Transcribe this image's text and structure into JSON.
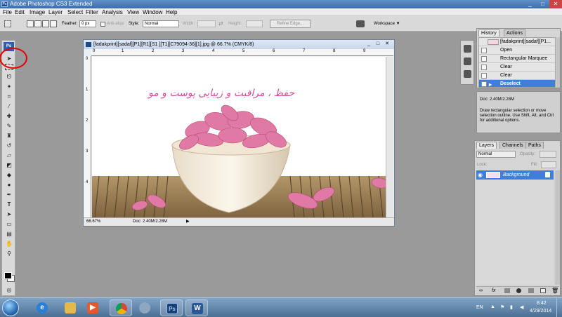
{
  "app": {
    "title": "Adobe Photoshop CS3 Extended",
    "icon_label": "Ps",
    "window_controls": [
      "_",
      "□",
      "✕"
    ]
  },
  "menu": [
    "File",
    "Edit",
    "Image",
    "Layer",
    "Select",
    "Filter",
    "Analysis",
    "View",
    "Window",
    "Help"
  ],
  "options": {
    "feather_label": "Feather:",
    "feather_value": "0 px",
    "antialias_label": "Anti-alias",
    "style_label": "Style:",
    "style_value": "Normal",
    "width_label": "Width:",
    "height_label": "Height:",
    "refine_edge": "Refine Edge...",
    "workspace": "Workspace ▼"
  },
  "document": {
    "title": "[fadakprint][sadaf][P1][R1][S1 ][T1][C79094-36][1].jpg @ 66.7% (CMYK/8)",
    "zoom": "66.67%",
    "doc_size": "Doc: 2.40M/2.28M",
    "ruler_top": [
      "0",
      "1",
      "2",
      "3",
      "4",
      "5",
      "6",
      "7",
      "8",
      "9"
    ],
    "ruler_left": [
      "0",
      "1",
      "2",
      "3",
      "4"
    ],
    "calligraphy": "حفظ ، مراقبت و زیبایی پوست و مو"
  },
  "history": {
    "tabs": [
      "History",
      "Actions"
    ],
    "snapshot": "[fadakprint][sadaf][P1...",
    "items": [
      "Open",
      "Rectangular Marquee",
      "Clear",
      "Clear",
      "Deselect"
    ],
    "selected_index": 4
  },
  "info": {
    "doc": "Doc: 2.40M/2.28M",
    "hint": "Draw rectangular selection or move selection outline. Use Shift, Alt, and Ctrl for additional options."
  },
  "layers": {
    "tabs": [
      "Layers",
      "Channels",
      "Paths"
    ],
    "blend_mode": "Normal",
    "opacity_label": "Opacity:",
    "fill_label": "Fill:",
    "lock_label": "Lock:",
    "layer_name": "Background"
  },
  "taskbar": {
    "language": "EN",
    "time": "8:42",
    "date": "4/29/2014",
    "apps": [
      "Internet Explorer",
      "Windows Explorer",
      "Media Player",
      "Google Chrome",
      "Network",
      "Adobe Photoshop",
      "Microsoft Word"
    ],
    "app_labels": [
      "e",
      "",
      "▶",
      "",
      "",
      "Ps",
      "W"
    ]
  },
  "colors": {
    "accent": "#3e7fd9",
    "calligraphy": "#d3509a",
    "annotation": "#e40000"
  }
}
